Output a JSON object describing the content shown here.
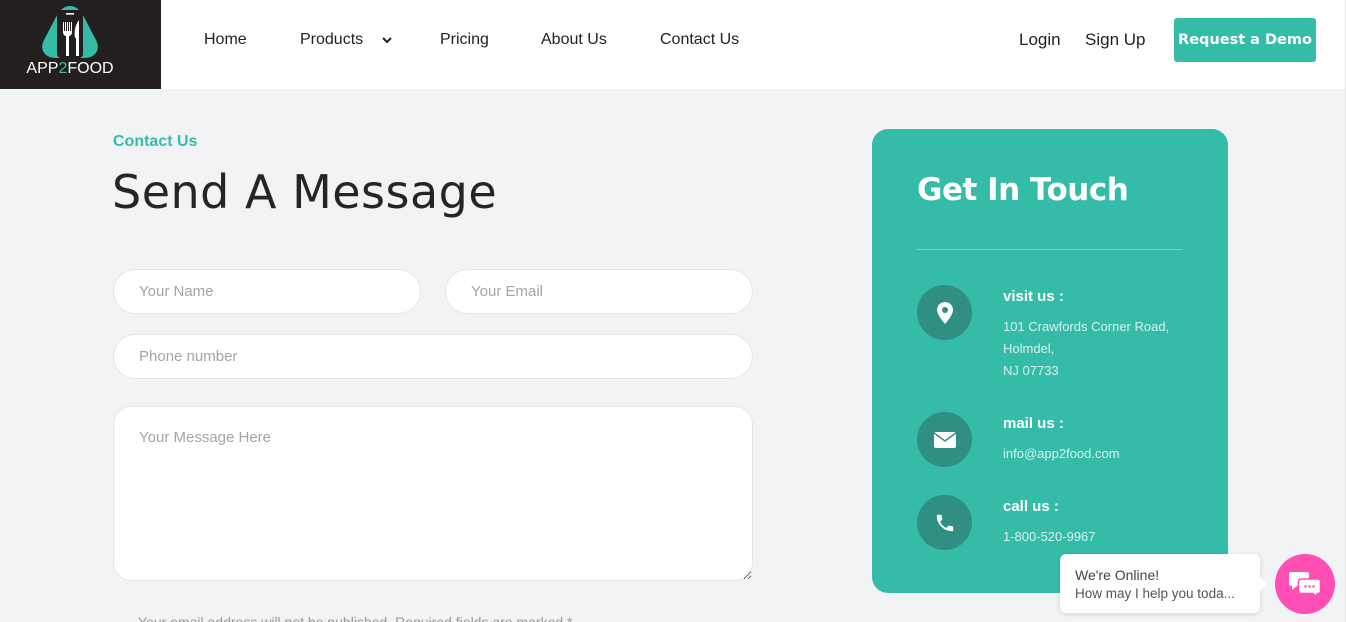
{
  "brand": {
    "name_prefix": "APP",
    "name_accent": "2",
    "name_suffix": "FOOD",
    "accent_color": "#35bca9",
    "logo_bg": "#231f1f"
  },
  "nav": {
    "items": [
      {
        "label": "Home",
        "icon": null
      },
      {
        "label": "Products",
        "icon": "chevron-down-icon"
      },
      {
        "label": "Pricing",
        "icon": null
      },
      {
        "label": "About Us",
        "icon": null
      },
      {
        "label": "Contact Us",
        "icon": null
      }
    ],
    "login": "Login",
    "signup": "Sign Up",
    "cta": "Request a Demo"
  },
  "contact_form": {
    "eyebrow": "Contact Us",
    "title": "Send A Message",
    "name_placeholder": "Your Name",
    "email_placeholder": "Your Email",
    "phone_placeholder": "Phone number",
    "message_placeholder": "Your Message Here",
    "notice": "Your email address will not be published. Required fields are marked *"
  },
  "get_in_touch": {
    "title": "Get In Touch",
    "card_color": "#35bca9",
    "items": [
      {
        "icon": "map-marker-icon",
        "label": "visit us :",
        "lines": [
          "101 Crawfords Corner Road,",
          "Holmdel,",
          "NJ 07733"
        ]
      },
      {
        "icon": "envelope-icon",
        "label": "mail us :",
        "lines": [
          "info@app2food.com"
        ]
      },
      {
        "icon": "phone-icon",
        "label": "call us :",
        "lines": [
          "1-800-520-9967"
        ]
      }
    ]
  },
  "chat_widget": {
    "status": "We're Online!",
    "prompt": "How may I help you toda...",
    "button_color": "#ff4fb5",
    "icon": "chat-bubbles-icon"
  }
}
